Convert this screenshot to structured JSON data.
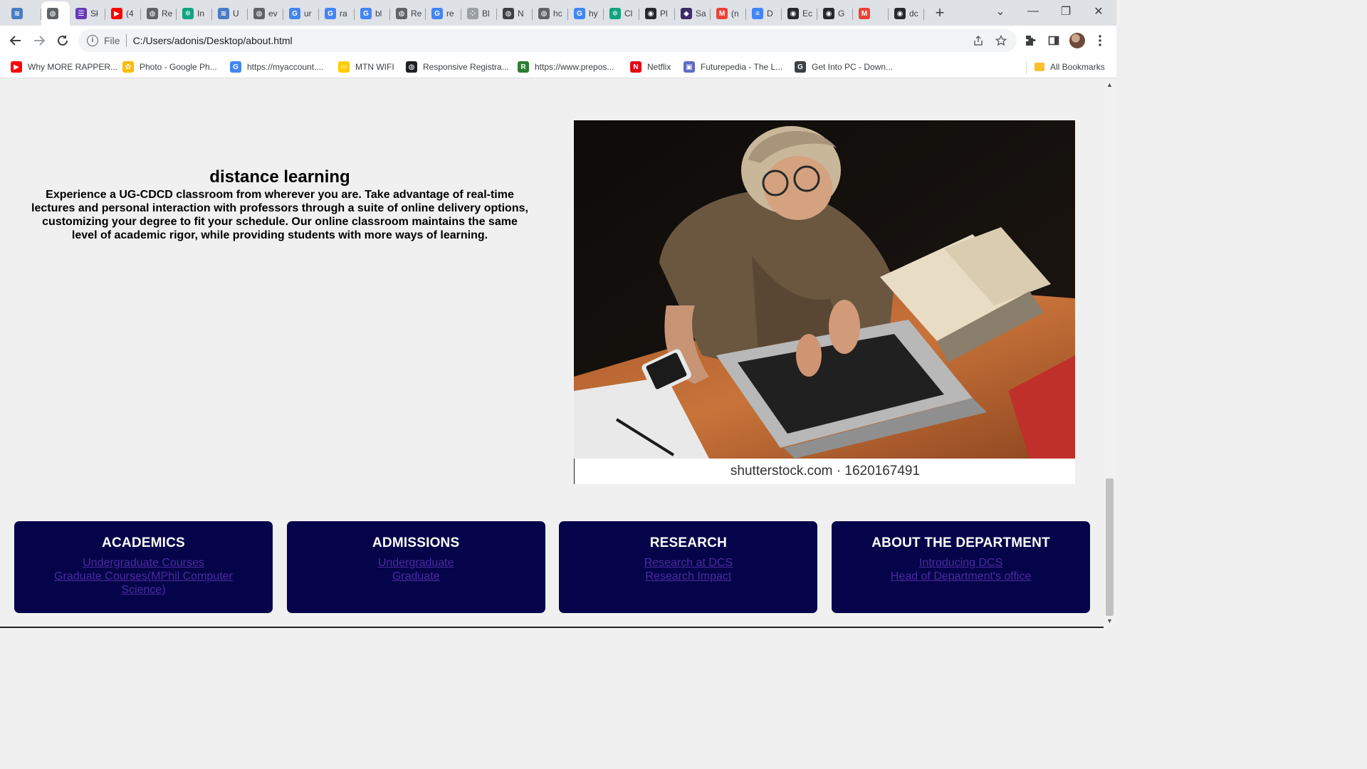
{
  "browser": {
    "tabs": [
      {
        "label": "",
        "icon": "hubs-icon",
        "color": "#4a7cc4",
        "active": false
      },
      {
        "label": "",
        "icon": "globe-icon",
        "color": "#5f6368",
        "active": true
      },
      {
        "label": "Sł",
        "icon": "forms-icon",
        "color": "#673ab7",
        "active": false
      },
      {
        "label": "(4",
        "icon": "youtube-icon",
        "color": "#ff0000",
        "active": false
      },
      {
        "label": "Re",
        "icon": "globe-icon",
        "color": "#5f6368",
        "active": false
      },
      {
        "label": "In",
        "icon": "openai-icon",
        "color": "#10a37f",
        "active": false
      },
      {
        "label": "U",
        "icon": "hubs-icon",
        "color": "#4a7cc4",
        "active": false
      },
      {
        "label": "ev",
        "icon": "globe-icon",
        "color": "#5f6368",
        "active": false
      },
      {
        "label": "ur",
        "icon": "google-icon",
        "color": "#4285f4",
        "active": false
      },
      {
        "label": "ra",
        "icon": "google-icon",
        "color": "#4285f4",
        "active": false
      },
      {
        "label": "bl",
        "icon": "google-icon",
        "color": "#4285f4",
        "active": false
      },
      {
        "label": "Re",
        "icon": "globe-icon",
        "color": "#5f6368",
        "active": false
      },
      {
        "label": "re",
        "icon": "google-icon",
        "color": "#4285f4",
        "active": false
      },
      {
        "label": "Bl",
        "icon": "dots-icon",
        "color": "#9aa0a6",
        "active": false
      },
      {
        "label": "N",
        "icon": "globe-icon",
        "color": "#3c4043",
        "active": false
      },
      {
        "label": "hc",
        "icon": "globe-icon",
        "color": "#5f6368",
        "active": false
      },
      {
        "label": "hy",
        "icon": "google-icon",
        "color": "#4285f4",
        "active": false
      },
      {
        "label": "Cl",
        "icon": "openai-icon",
        "color": "#10a37f",
        "active": false
      },
      {
        "label": "Pl",
        "icon": "github-icon",
        "color": "#24292e",
        "active": false
      },
      {
        "label": "Sa",
        "icon": "shield-icon",
        "color": "#3d2b6b",
        "active": false
      },
      {
        "label": "(n",
        "icon": "gmail-icon",
        "color": "#ea4335",
        "active": false
      },
      {
        "label": "D",
        "icon": "docs-icon",
        "color": "#4285f4",
        "active": false
      },
      {
        "label": "Ec",
        "icon": "github-icon",
        "color": "#24292e",
        "active": false
      },
      {
        "label": "G",
        "icon": "github-icon",
        "color": "#24292e",
        "active": false
      },
      {
        "label": "",
        "icon": "gmail-icon",
        "color": "#ea4335",
        "active": false
      },
      {
        "label": "dc",
        "icon": "github-icon",
        "color": "#24292e",
        "active": false
      }
    ],
    "new_tab_symbol": "+",
    "tab_search_symbol": "⌄",
    "minimize_symbol": "—",
    "restore_symbol": "❐",
    "close_symbol": "✕",
    "address": {
      "scheme_label": "File",
      "url": "C:/Users/adonis/Desktop/about.html"
    },
    "bookmarks": [
      {
        "label": "Why MORE RAPPER...",
        "icon": "youtube-icon",
        "color": "#ff0000"
      },
      {
        "label": "Photo - Google Ph...",
        "icon": "photos-icon",
        "color": "#fbbc04"
      },
      {
        "label": "https://myaccount....",
        "icon": "google-icon",
        "color": "#4285f4"
      },
      {
        "label": "MTN WIFI",
        "icon": "mtn-icon",
        "color": "#ffcc00"
      },
      {
        "label": "Responsive Registra...",
        "icon": "globe-icon",
        "color": "#202124"
      },
      {
        "label": "https://www.prepos...",
        "icon": "prepostseo-icon",
        "color": "#2e7d32"
      },
      {
        "label": "Netflix",
        "icon": "netflix-icon",
        "color": "#e50914"
      },
      {
        "label": "Futurepedia - The L...",
        "icon": "futurepedia-icon",
        "color": "#5c6bc0"
      },
      {
        "label": "Get Into PC - Down...",
        "icon": "getintopc-icon",
        "color": "#3c4043"
      }
    ],
    "all_bookmarks_label": "All Bookmarks"
  },
  "page": {
    "heading": "distance learning",
    "paragraph": "Experience a UG-CDCD classroom from wherever you are. Take advantage of real-time lectures and personal interaction with professors through a suite of online delivery options, customizing your degree to fit your schedule. Our online classroom maintains the same level of academic rigor, while providing students with more ways of learning.",
    "image_caption": "shutterstock.com · 1620167491",
    "cards": [
      {
        "title": "ACADEMICS",
        "links": [
          "Undergraduate Courses",
          "Graduate Courses(MPhil Computer Science)"
        ]
      },
      {
        "title": "ADMISSIONS",
        "links": [
          "Undergraduate",
          "Graduate"
        ]
      },
      {
        "title": "RESEARCH",
        "links": [
          "Research at DCS",
          "Research Impact"
        ]
      },
      {
        "title": "ABOUT THE DEPARTMENT",
        "links": [
          "Introducing DCS",
          "Head of Department's office"
        ]
      }
    ]
  },
  "colors": {
    "card_background": "#05044a",
    "link_color": "#4b2a9e",
    "page_background": "#f0f0f0"
  }
}
